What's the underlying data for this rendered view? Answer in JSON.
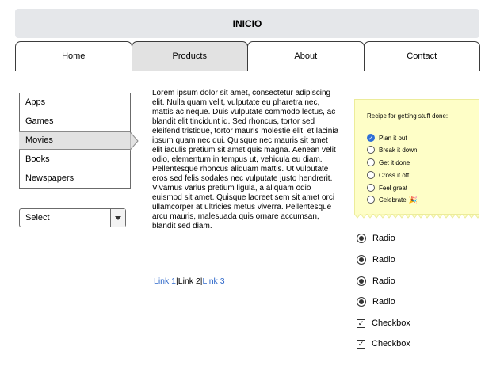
{
  "header": {
    "title": "INICIO"
  },
  "tabs": [
    {
      "label": "Home",
      "active": false
    },
    {
      "label": "Products",
      "active": true
    },
    {
      "label": "About",
      "active": false
    },
    {
      "label": "Contact",
      "active": false
    }
  ],
  "sidebar": {
    "items": [
      {
        "label": "Apps"
      },
      {
        "label": "Games"
      },
      {
        "label": "Movies",
        "active": true
      },
      {
        "label": "Books"
      },
      {
        "label": "Newspapers"
      }
    ]
  },
  "select": {
    "value": "Select"
  },
  "content": {
    "paragraph": "Lorem ipsum dolor sit amet, consectetur adipiscing elit. Nulla quam velit, vulputate eu pharetra nec, mattis ac neque. Duis vulputate commodo lectus, ac blandit elit tincidunt id. Sed rhoncus, tortor sed eleifend tristique, tortor mauris molestie elit, et lacinia ipsum quam nec dui. Quisque nec mauris sit amet elit iaculis pretium sit amet quis magna. Aenean velit odio, elementum in tempus ut, vehicula eu diam. Pellentesque rhoncus aliquam mattis. Ut vulputate eros sed felis sodales nec vulputate justo hendrerit. Vivamus varius pretium ligula, a aliquam odio euismod sit amet. Quisque laoreet sem sit amet orci ullamcorper at ultricies metus viverra. Pellentesque arcu mauris, malesuada quis ornare accumsan, blandit sed diam.",
    "links": [
      "Link 1",
      "Link 2",
      "Link 3"
    ]
  },
  "note": {
    "title": "Recipe for getting stuff done:",
    "tasks": [
      {
        "label": "Plan it out",
        "checked": true
      },
      {
        "label": "Break it down",
        "checked": false
      },
      {
        "label": "Get it done",
        "checked": false
      },
      {
        "label": "Cross it off",
        "checked": false
      },
      {
        "label": "Feel great",
        "checked": false
      },
      {
        "label": "Celebrate",
        "checked": false
      }
    ]
  },
  "options": {
    "radios": [
      "Radio",
      "Radio",
      "Radio",
      "Radio"
    ],
    "checkboxes": [
      "Checkbox",
      "Checkbox"
    ]
  },
  "colors": {
    "header_bg": "#e5e7ea",
    "active_tab_bg": "#e2e2e2",
    "link": "#2d67c9",
    "note_bg": "#fefec7",
    "checked_task": "#2f6fd6"
  }
}
